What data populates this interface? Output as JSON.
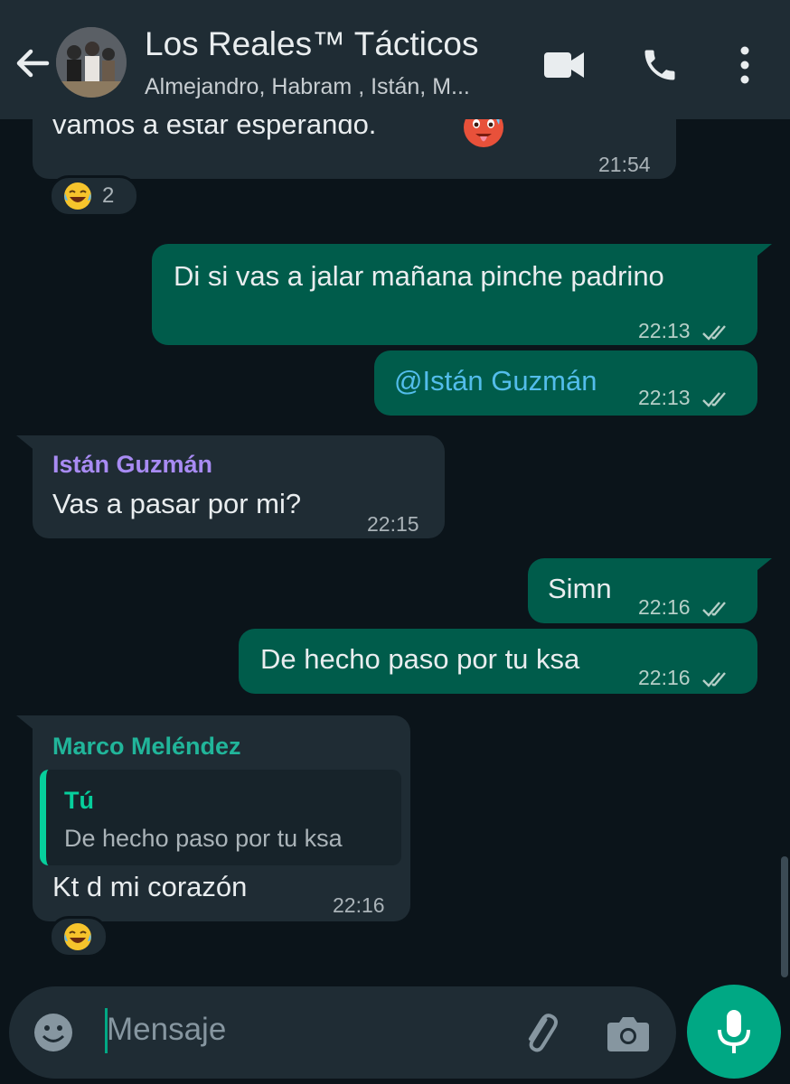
{
  "header": {
    "title": "Los Reales™ Tácticos",
    "subtitle": "Almejandro, Habram , Istán, M..."
  },
  "messages": [
    {
      "text": "vamos a estar esperando.",
      "time": "21:54",
      "reaction_count": "2"
    },
    {
      "text": "Di si vas a jalar mañana pinche padrino",
      "time": "22:13"
    },
    {
      "text": "@Istán Guzmán",
      "time": "22:13"
    },
    {
      "sender": "Istán Guzmán",
      "text": "Vas a pasar por mi?",
      "time": "22:15"
    },
    {
      "text": "Simn",
      "time": "22:16"
    },
    {
      "text": "De hecho paso por tu ksa",
      "time": "22:16"
    },
    {
      "sender": "Marco Meléndez",
      "quote_author": "Tú",
      "quote_text": "De hecho paso por tu ksa",
      "text": "Kt d mi corazón",
      "time": "22:16"
    }
  ],
  "input": {
    "placeholder": "Mensaje"
  },
  "colors": {
    "background": "#0b141a",
    "incoming": "#1f2c34",
    "outgoing": "#005c4b",
    "accent": "#00a884",
    "sender_istan": "#a88bf3",
    "sender_marco": "#21b59a",
    "mention": "#53bdeb"
  },
  "icons": [
    "back-arrow-icon",
    "video-call-icon",
    "phone-icon",
    "more-vert-icon",
    "emoji-icon",
    "attach-icon",
    "camera-icon",
    "mic-icon",
    "double-check-icon",
    "hot-face-emoji",
    "laughing-emoji"
  ]
}
